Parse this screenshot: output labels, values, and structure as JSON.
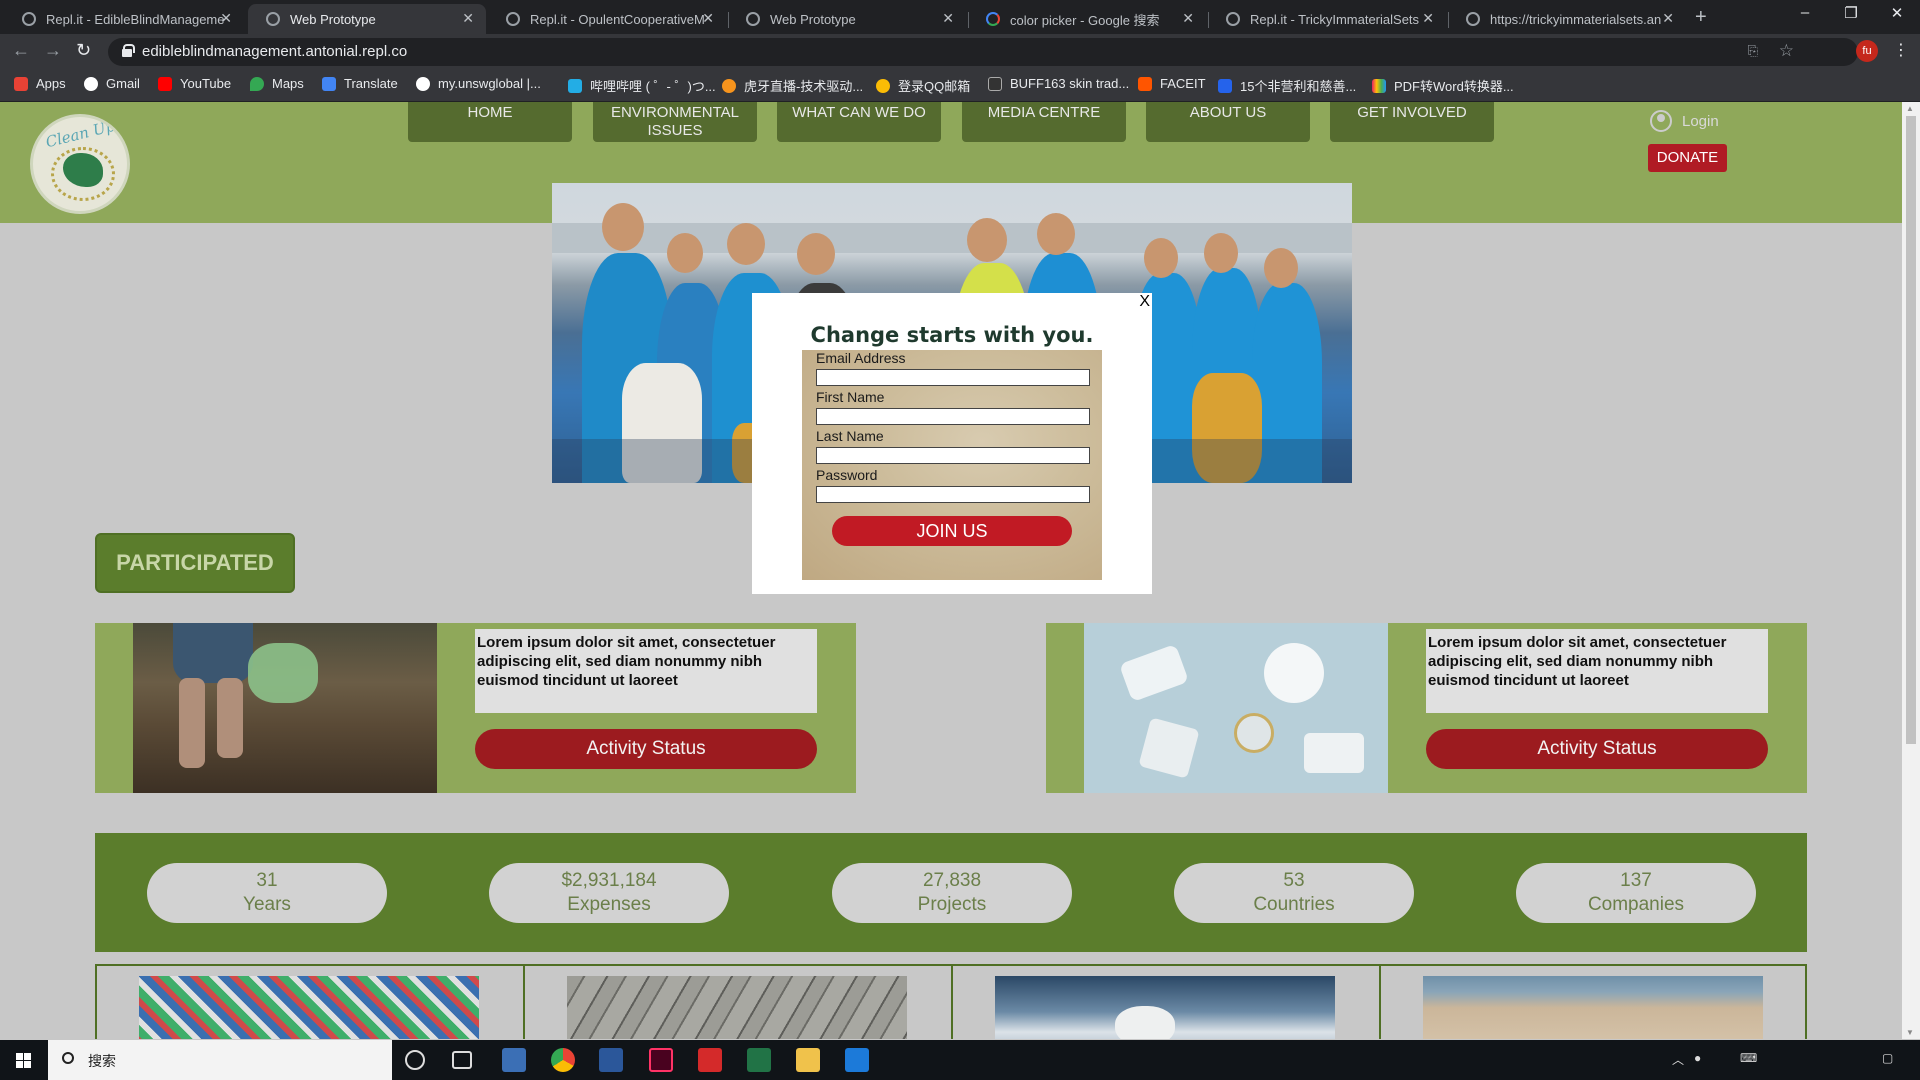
{
  "browser": {
    "tabs": [
      {
        "title": "Repl.it - EdibleBlindManagement",
        "active": false,
        "favicon": "replit-icon"
      },
      {
        "title": "Web Prototype",
        "active": true,
        "favicon": "globe-icon"
      },
      {
        "title": "Repl.it - OpulentCooperativeM",
        "active": false,
        "favicon": "replit-icon"
      },
      {
        "title": "Web Prototype",
        "active": false,
        "favicon": "globe-icon"
      },
      {
        "title": "color picker - Google 搜索",
        "active": false,
        "favicon": "google-icon"
      },
      {
        "title": "Repl.it - TrickyImmaterialSets",
        "active": false,
        "favicon": "replit-icon"
      },
      {
        "title": "https://trickyimmaterialsets.an",
        "active": false,
        "favicon": "globe-icon"
      }
    ],
    "new_tab": "+",
    "window_controls": {
      "minimize": "–",
      "restore": "❐",
      "close": "✕"
    },
    "url": "edibleblindmanagement.antonial.repl.co",
    "profile_initials": "fu",
    "bookmarks": [
      {
        "label": "Apps",
        "color": "#e94235"
      },
      {
        "label": "Gmail",
        "color": "#ffffff"
      },
      {
        "label": "YouTube",
        "color": "#ff0000"
      },
      {
        "label": "Maps",
        "color": "#34a853"
      },
      {
        "label": "Translate",
        "color": "#4285f4"
      },
      {
        "label": "my.unswglobal |...",
        "color": "#ffffff"
      },
      {
        "label": "哔哩哔哩 ( ゜- ゜)つ...",
        "color": "#23ade5"
      },
      {
        "label": "虎牙直播-技术驱动...",
        "color": "#f7941d"
      },
      {
        "label": "登录QQ邮箱",
        "color": "#fbbc05"
      },
      {
        "label": "BUFF163 skin trad...",
        "color": "#ffffff"
      },
      {
        "label": "FACEIT",
        "color": "#ff5500"
      },
      {
        "label": "15个非营利和慈善...",
        "color": "#2563eb"
      },
      {
        "label": "PDF转Word转换器...",
        "color": "#e91e63"
      }
    ]
  },
  "site": {
    "logo_text": "Clean Up",
    "nav": [
      {
        "label": "HOME"
      },
      {
        "label": "ENVIRONMENTAL ISSUES"
      },
      {
        "label": "WHAT CAN WE DO"
      },
      {
        "label": "MEDIA CENTRE"
      },
      {
        "label": "ABOUT US"
      },
      {
        "label": "GET INVOLVED"
      }
    ],
    "login_label": "Login",
    "donate_label": "DONATE",
    "section_title": "PARTICIPATED",
    "cards": [
      {
        "text": "Lorem ipsum dolor sit amet, consectetuer adipiscing elit, sed diam nonummy nibh euismod tincidunt ut laoreet",
        "button": "Activity Status"
      },
      {
        "text": "Lorem ipsum dolor sit amet, consectetuer adipiscing elit, sed diam nonummy nibh euismod tincidunt ut laoreet",
        "button": "Activity Status"
      }
    ],
    "stats": [
      {
        "value": "31",
        "label": "Years"
      },
      {
        "value": "$2,931,184",
        "label": "Expenses"
      },
      {
        "value": "27,838",
        "label": "Projects"
      },
      {
        "value": "53",
        "label": "Countries"
      },
      {
        "value": "137",
        "label": "Companies"
      }
    ],
    "colors": {
      "header_green": "#8fa85a",
      "dark_green": "#5b7d2c",
      "accent_red": "#b01b24"
    }
  },
  "modal": {
    "close_label": "X",
    "title": "Change starts with you.",
    "fields": [
      {
        "label": "Email Address",
        "value": ""
      },
      {
        "label": "First Name",
        "value": ""
      },
      {
        "label": "Last Name",
        "value": ""
      },
      {
        "label": "Password",
        "value": ""
      }
    ],
    "submit_label": "JOIN US"
  },
  "taskbar": {
    "search_placeholder": "搜索",
    "apps": [
      "cortana-icon",
      "task-view-icon",
      "store-icon",
      "chrome-icon",
      "word-icon",
      "indesign-icon",
      "wps-icon",
      "excel-icon",
      "file-explorer-icon",
      "app-icon"
    ]
  }
}
